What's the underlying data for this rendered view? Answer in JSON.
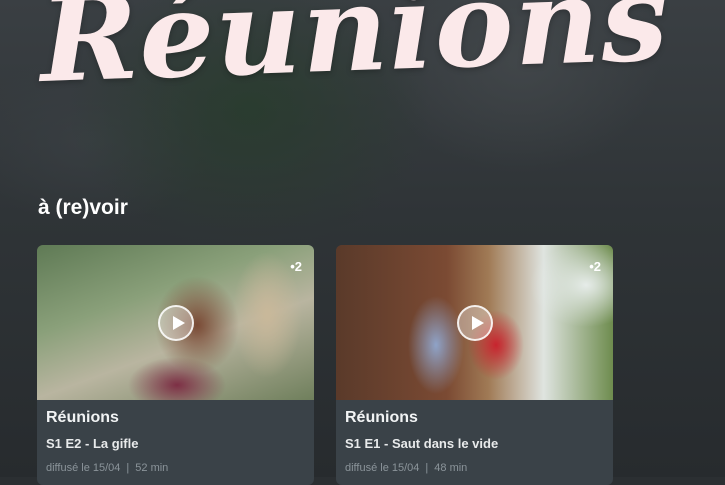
{
  "show": {
    "title": "Réunions"
  },
  "section": {
    "title": "à (re)voir"
  },
  "cards": [
    {
      "title": "Réunions",
      "episode": "S1 E2 - La gifle",
      "aired": "diffusé le 15/04",
      "duration": "52 min",
      "channel": "•2"
    },
    {
      "title": "Réunions",
      "episode": "S1 E1 - Saut dans le vide",
      "aired": "diffusé le 15/04",
      "duration": "48 min",
      "channel": "•2"
    }
  ],
  "icons": {
    "play": "play-icon"
  },
  "colors": {
    "title_pink": "#fbe9ea",
    "card_bg": "#3a4248",
    "meta_gray": "#8b949a"
  }
}
